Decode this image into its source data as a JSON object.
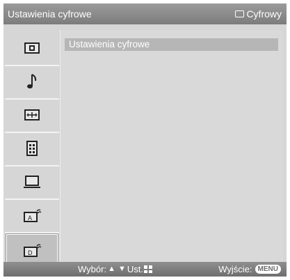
{
  "header": {
    "title": "Ustawienia cyfrowe",
    "mode_label": "Cyfrowy"
  },
  "sidebar": {
    "items": [
      {
        "icon": "picture-icon"
      },
      {
        "icon": "music-note-icon"
      },
      {
        "icon": "screen-icon"
      },
      {
        "icon": "settings-list-icon"
      },
      {
        "icon": "pc-monitor-icon"
      },
      {
        "icon": "analog-antenna-icon",
        "badge": "A"
      },
      {
        "icon": "digital-antenna-icon",
        "badge": "D",
        "selected": true
      }
    ]
  },
  "main": {
    "menu_item": "Ustawienia cyfrowe"
  },
  "footer": {
    "select_label": "Wybór:",
    "set_label": "Ust.",
    "exit_label": "Wyjście:",
    "menu_key": "MENU"
  },
  "colors": {
    "background": "#d6d6d6",
    "titlebar": "#8a8a8a",
    "highlight": "#b6b6b6"
  }
}
